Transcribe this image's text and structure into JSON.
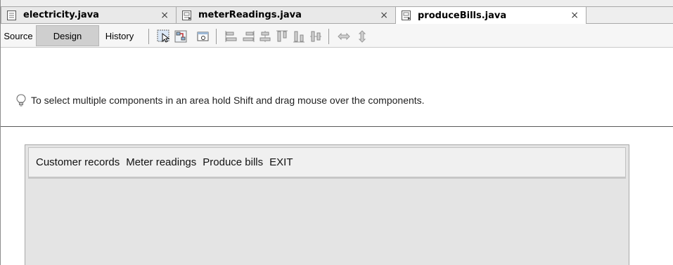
{
  "tabs": [
    {
      "label": "electricity.java",
      "close": "×",
      "icon": "java-form-icon"
    },
    {
      "label": "meterReadings.java",
      "close": "×",
      "icon": "java-form-icon"
    },
    {
      "label": "produceBills.java",
      "close": "×",
      "icon": "java-form-icon",
      "active": true
    }
  ],
  "views": {
    "source": "Source",
    "design": "Design",
    "history": "History"
  },
  "toolbar_icons": [
    "selection-mode-icon",
    "connection-mode-icon",
    "preview-design-icon",
    "align-left-icon",
    "align-right-icon",
    "center-horizontally-icon",
    "align-top-icon",
    "align-bottom-icon",
    "center-vertically-icon",
    "change-horizontal-resizability-icon",
    "change-vertical-resizability-icon"
  ],
  "hint": "To select multiple components in an area hold Shift and drag mouse over the components.",
  "menubar": [
    "Customer records",
    "Meter readings",
    "Produce bills",
    "EXIT"
  ]
}
